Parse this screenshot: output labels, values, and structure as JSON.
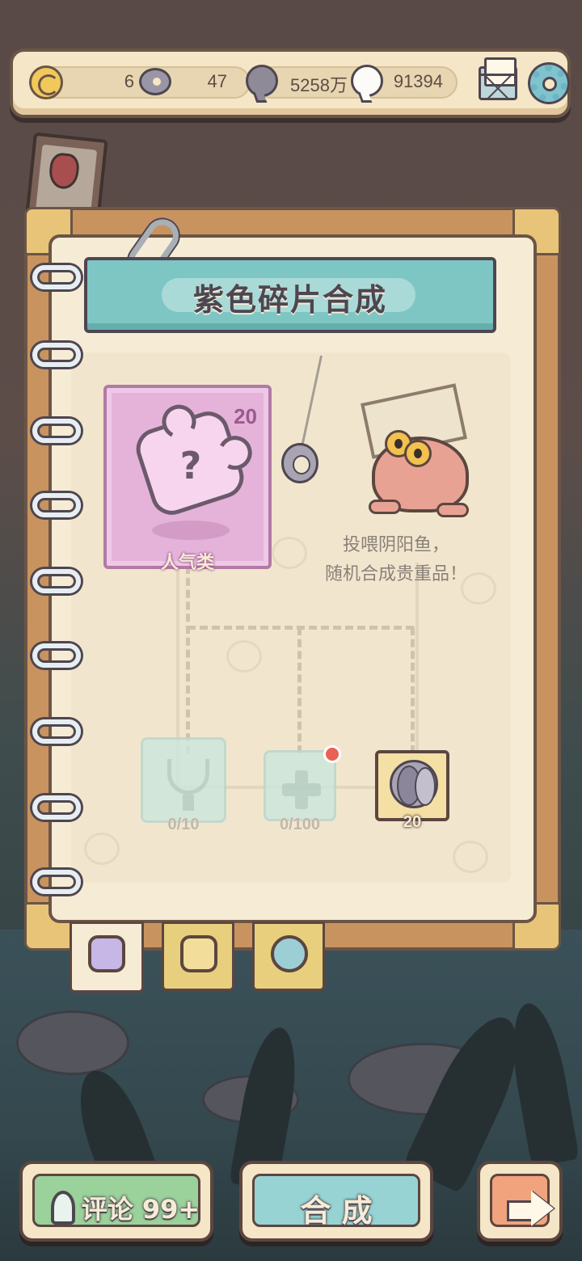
{
  "topbar": {
    "yinyang_count": "6",
    "fish_count": "47",
    "dark_bubble_count": "5258万",
    "light_bubble_count": "91394"
  },
  "panel": {
    "title": "紫色碎片合成",
    "card": {
      "count": "20",
      "label": "人气类"
    },
    "hint_line1": "投喂阴阳鱼，",
    "hint_line2": "随机合成贵重品！",
    "slots": [
      {
        "icon": "trophy-icon",
        "count": "0/10"
      },
      {
        "icon": "plus-icon",
        "count": "0/100",
        "has_notification": true
      },
      {
        "icon": "yinyang-fish-icon",
        "count": "20"
      }
    ]
  },
  "tabs": [
    {
      "icon": "purple-puzzle-icon",
      "color": "#c7b7e6",
      "selected": true
    },
    {
      "icon": "gold-puzzle-icon",
      "color": "#e8cf7e",
      "selected": false
    },
    {
      "icon": "exchange-icon",
      "color": "#e8cf7e",
      "selected": false
    }
  ],
  "buttons": {
    "comment_label": "评论 99+",
    "synthesize_label": "合 成"
  },
  "colors": {
    "title_banner": "#7ec6c4",
    "pink_card": "#e5b3da",
    "comment_button": "#9bd19a",
    "synthesize_button": "#97d3d3",
    "next_button": "#f1a37d"
  }
}
